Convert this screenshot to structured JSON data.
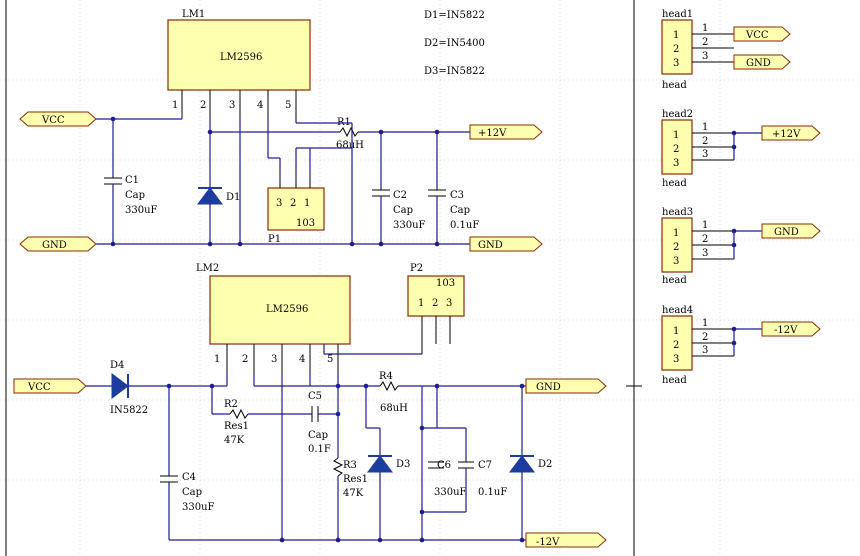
{
  "lm1": {
    "designator": "LM1",
    "part": "LM2596",
    "pins": [
      "1",
      "2",
      "3",
      "4",
      "5"
    ]
  },
  "lm2": {
    "designator": "LM2",
    "part": "LM2596",
    "pins": [
      "1",
      "2",
      "3",
      "4",
      "5"
    ]
  },
  "notes": {
    "d1": "D1=IN5822",
    "d2": "D2=IN5400",
    "d3": "D3=IN5822"
  },
  "ports": {
    "vcc_top": "VCC",
    "gnd_top": "GND",
    "p12_top": "+12V",
    "gnd_top_right": "GND",
    "vcc_bottom": "VCC",
    "gnd_bottom": "GND",
    "m12_bottom": "-12V",
    "head1_vcc": "VCC",
    "head1_gnd": "GND",
    "head2_p12": "+12V",
    "head3_gnd": "GND",
    "head4_m12": "-12V"
  },
  "top": {
    "c1": {
      "ref": "C1",
      "type": "Cap",
      "value": "330uF"
    },
    "c2": {
      "ref": "C2",
      "type": "Cap",
      "value": "330uF"
    },
    "c3": {
      "ref": "C3",
      "type": "Cap",
      "value": "0.1uF"
    },
    "d1": {
      "ref": "D1"
    },
    "r1": {
      "ref": "R1",
      "value": "68uH"
    },
    "p1": {
      "ref": "P1",
      "value": "103",
      "pins": [
        "3",
        "2",
        "1"
      ]
    }
  },
  "bottom": {
    "d4": {
      "ref": "D4",
      "value": "IN5822"
    },
    "r2": {
      "ref": "R2",
      "type": "Res1",
      "value": "47K"
    },
    "r3": {
      "ref": "R3",
      "type": "Res1",
      "value": "47K"
    },
    "r4": {
      "ref": "R4",
      "value": "68uH"
    },
    "c4": {
      "ref": "C4",
      "type": "Cap",
      "value": "330uF"
    },
    "c5": {
      "ref": "C5",
      "type": "Cap",
      "value": "0.1F"
    },
    "c6": {
      "ref": "C6",
      "value": "330uF"
    },
    "c7": {
      "ref": "C7",
      "value": "0.1uF"
    },
    "d2": {
      "ref": "D2"
    },
    "d3": {
      "ref": "D3"
    },
    "p2": {
      "ref": "P2",
      "value": "103",
      "pins": [
        "1",
        "2",
        "3"
      ]
    }
  },
  "headers": [
    {
      "name": "head1",
      "label": "head",
      "pins": [
        "1",
        "2",
        "3"
      ],
      "wire_nums": [
        "1",
        "2",
        "3"
      ]
    },
    {
      "name": "head2",
      "label": "head",
      "pins": [
        "1",
        "2",
        "3"
      ],
      "wire_nums": [
        "1",
        "2",
        "3"
      ]
    },
    {
      "name": "head3",
      "label": "head",
      "pins": [
        "1",
        "2",
        "3"
      ],
      "wire_nums": [
        "1",
        "2",
        "3"
      ]
    },
    {
      "name": "head4",
      "label": "head",
      "pins": [
        "1",
        "2",
        "3"
      ],
      "wire_nums": [
        "1",
        "2",
        "3"
      ]
    }
  ],
  "colors": {
    "wire": "#1c1c96",
    "component_fill": "#ffffb0",
    "component_border": "#8a2a00",
    "diode": "#1c3ca0"
  }
}
